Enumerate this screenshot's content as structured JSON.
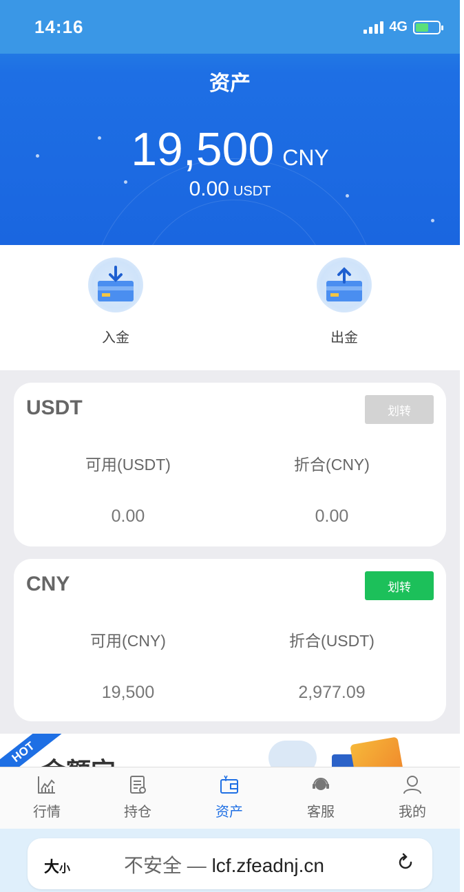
{
  "status_bar": {
    "time": "14:16",
    "network": "4G"
  },
  "header": {
    "title": "资产",
    "total_value": "19,500",
    "total_unit": "CNY",
    "usdt_value": "0.00",
    "usdt_unit": "USDT"
  },
  "actions": {
    "deposit_label": "入金",
    "withdraw_label": "出金"
  },
  "cards": [
    {
      "title": "USDT",
      "button_label": "划转",
      "button_color": "#d3d3d3",
      "col1_label": "可用(USDT)",
      "col1_value": "0.00",
      "col2_label": "折合(CNY)",
      "col2_value": "0.00"
    },
    {
      "title": "CNY",
      "button_label": "划转",
      "button_color": "#1cc05a",
      "col1_label": "可用(CNY)",
      "col1_value": "19,500",
      "col2_label": "折合(USDT)",
      "col2_value": "2,977.09"
    }
  ],
  "promo": {
    "badge": "HOT",
    "text": "金额宝"
  },
  "tabbar": {
    "items": [
      {
        "label": "行情",
        "icon": "chart-icon"
      },
      {
        "label": "持仓",
        "icon": "document-icon"
      },
      {
        "label": "资产",
        "icon": "wallet-icon",
        "active": true
      },
      {
        "label": "客服",
        "icon": "headset-icon"
      },
      {
        "label": "我的",
        "icon": "user-icon"
      }
    ]
  },
  "browser": {
    "text_size_big": "大",
    "text_size_small": "小",
    "insecure_label": "不安全",
    "separator": "—",
    "url": "lcf.zfeadnj.cn"
  },
  "colors": {
    "header_blue": "#1e6fe4",
    "active_tab": "#1e6fe4",
    "transfer_green": "#1cc05a",
    "transfer_disabled": "#d3d3d3"
  }
}
